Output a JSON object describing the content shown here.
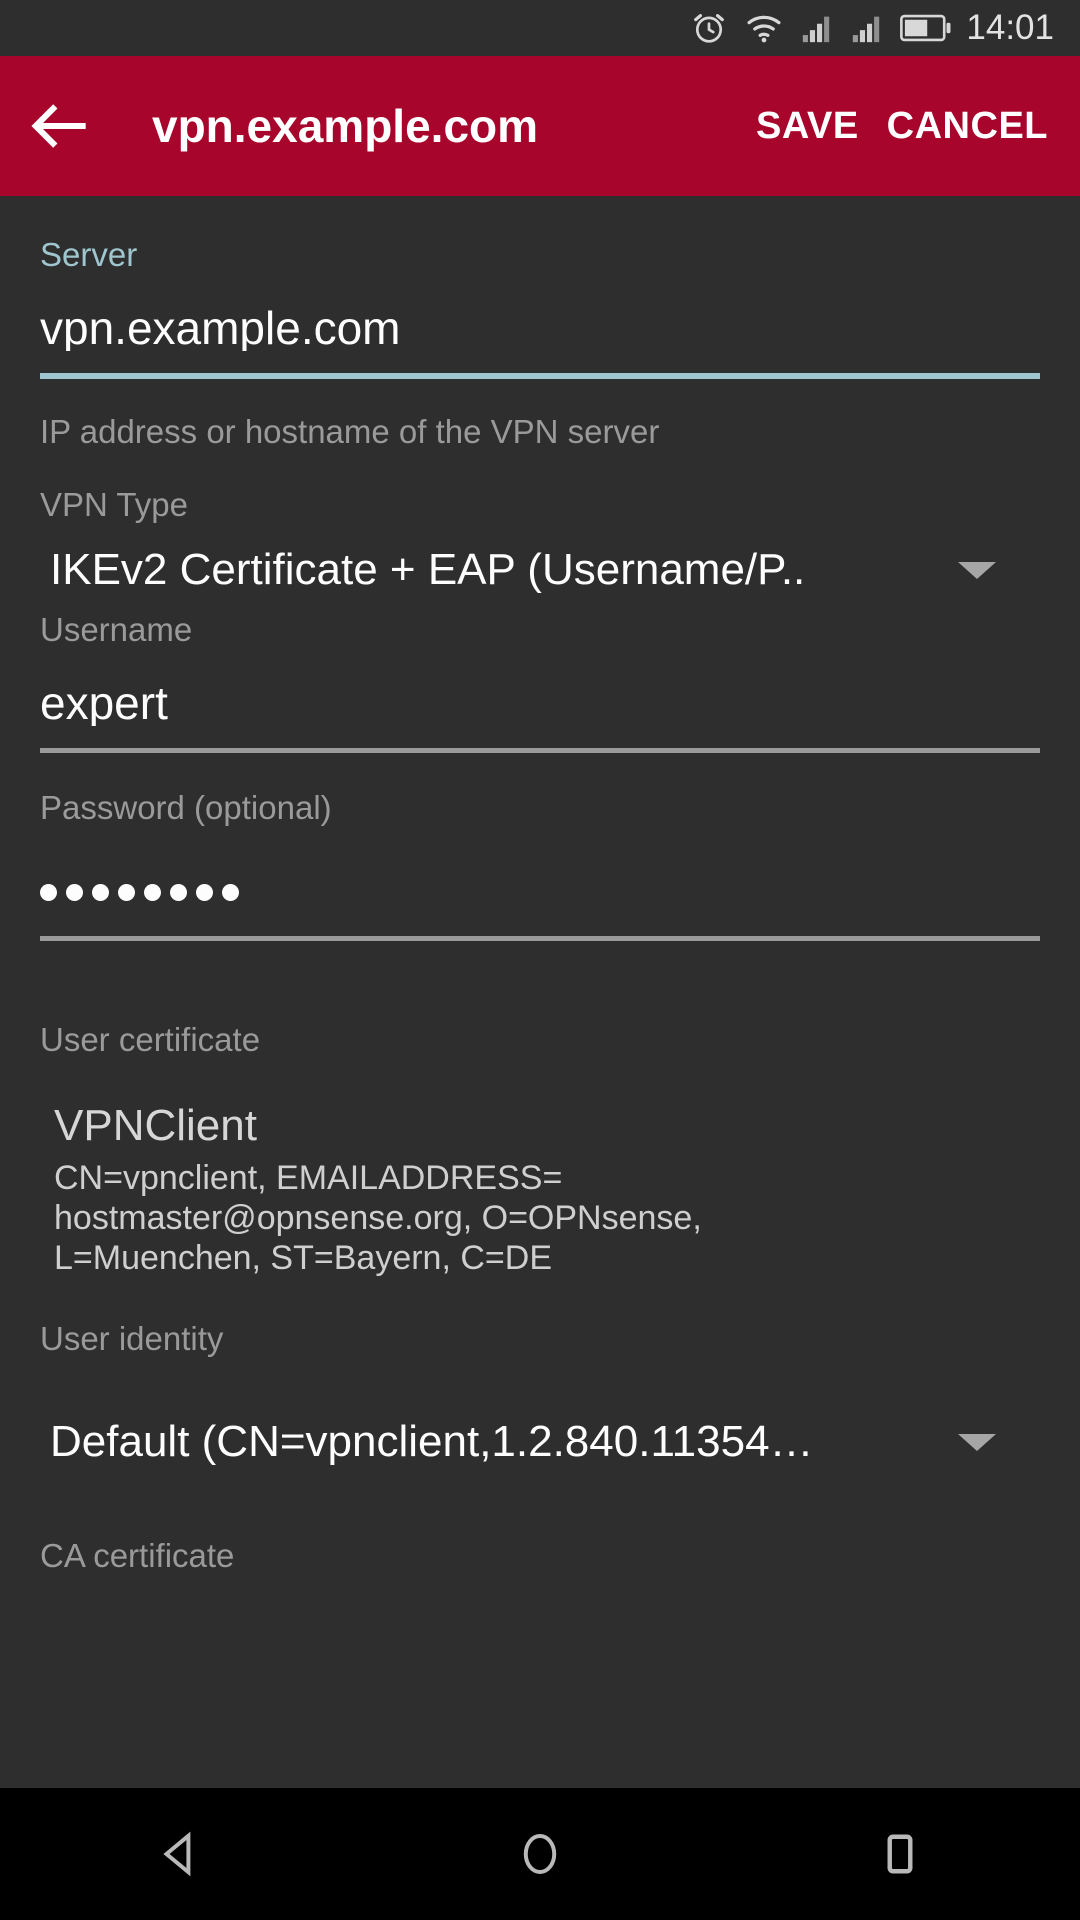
{
  "status_bar": {
    "time": "14:01",
    "icons": [
      "alarm-icon",
      "wifi-icon",
      "signal-bars-sim1-icon",
      "signal-bars-sim2-icon",
      "battery-icon"
    ],
    "battery_level_percent": 60,
    "background_color": "#2e2e2e"
  },
  "app_bar": {
    "back_label": "back-arrow",
    "title": "vpn.example.com",
    "save_label": "SAVE",
    "cancel_label": "CANCEL",
    "background_color": "#a8052c",
    "text_color": "#ffffff"
  },
  "form": {
    "accent_color": "#9fc6ce",
    "server": {
      "label": "Server",
      "value": "vpn.example.com",
      "placeholder": "Server",
      "helper": "IP address or hostname of the VPN server",
      "focused": true
    },
    "vpn_type": {
      "label": "VPN Type",
      "value": "IKEv2 Certificate + EAP (Username/P..",
      "arrow": "chevron-down-icon"
    },
    "username": {
      "label": "Username",
      "value": "expert",
      "placeholder": "Username"
    },
    "password": {
      "label": "Password (optional)",
      "placeholder": "Password (optional)",
      "masked_char_count": 8
    },
    "user_certificate": {
      "label": "User certificate",
      "name": "VPNClient",
      "subject_lines": [
        "CN=vpnclient, EMAILADDRESS=",
        "hostmaster@opnsense.org, O=OPNsense,",
        "L=Muenchen, ST=Bayern, C=DE"
      ]
    },
    "user_identity": {
      "label": "User identity",
      "value": "Default (CN=vpnclient,1.2.840.11354…",
      "arrow": "chevron-down-icon"
    },
    "ca_certificate": {
      "label": "CA certificate"
    }
  },
  "nav_bar": {
    "back": "back-triangle-icon",
    "home": "home-circle-icon",
    "recents": "recents-square-icon",
    "background_color": "#000000"
  }
}
